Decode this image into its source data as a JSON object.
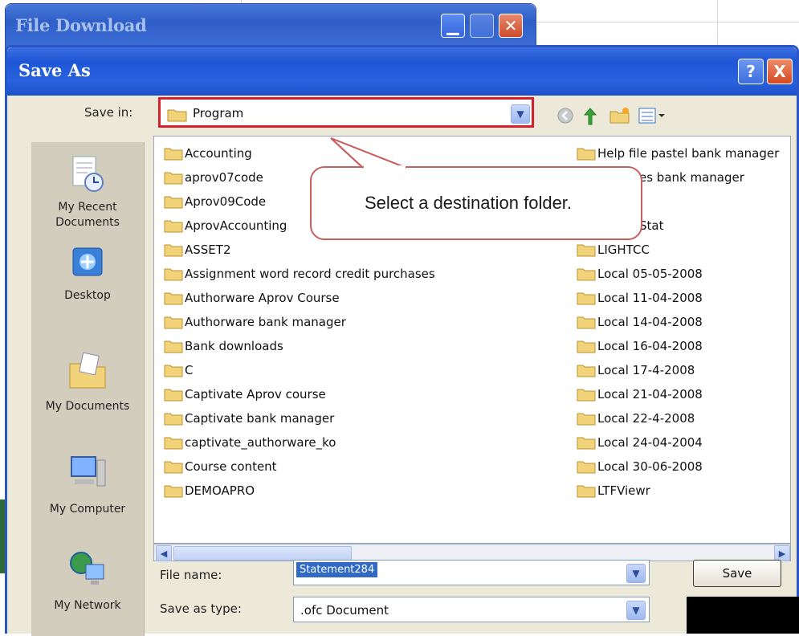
{
  "file_download_dialog": {
    "title": "File Download"
  },
  "save_as_dialog": {
    "title": "Save As",
    "help_label": "?",
    "close_label": "X",
    "save_in_label": "Save in:",
    "save_in_value": "Program",
    "places": [
      {
        "label": "My Recent Documents",
        "icon": "recent-documents-icon"
      },
      {
        "label": "Desktop",
        "icon": "desktop-icon"
      },
      {
        "label": "My Documents",
        "icon": "my-documents-icon"
      },
      {
        "label": "My Computer",
        "icon": "my-computer-icon"
      },
      {
        "label": "My Network",
        "icon": "my-network-icon"
      }
    ],
    "folders_left": [
      "Accounting",
      "aprov07code",
      "Aprov09Code",
      "AprovAccounting",
      "ASSET2",
      "Assignment word record credit purchases",
      "Authorware Aprov Course",
      "Authorware bank manager",
      "Bank downloads",
      "C",
      "Captivate Aprov course",
      "Captivate bank manager",
      "captivate_authorware_ko",
      "Course content",
      "DEMOAPRO"
    ],
    "folders_right": [
      "Help file pastel bank manager",
      "es bank manager",
      "",
      "Stat",
      "LIGHTCC",
      "Local 05-05-2008",
      "Local 11-04-2008",
      "Local 14-04-2008",
      "Local 16-04-2008",
      "Local 17-4-2008",
      "Local 21-04-2008",
      "Local 22-4-2008",
      "Local 24-04-2004",
      "Local 30-06-2008",
      "LTFViewr"
    ],
    "file_name_label": "File name:",
    "file_name_value": "Statement284",
    "save_as_type_label": "Save as type:",
    "save_as_type_value": ".ofc Document",
    "save_button": "Save"
  },
  "callout": {
    "text": "Select a destination folder."
  },
  "colors": {
    "highlight_border": "#d7202c",
    "callout_border": "#c85f5f",
    "title_blue": "#2a56c6"
  }
}
